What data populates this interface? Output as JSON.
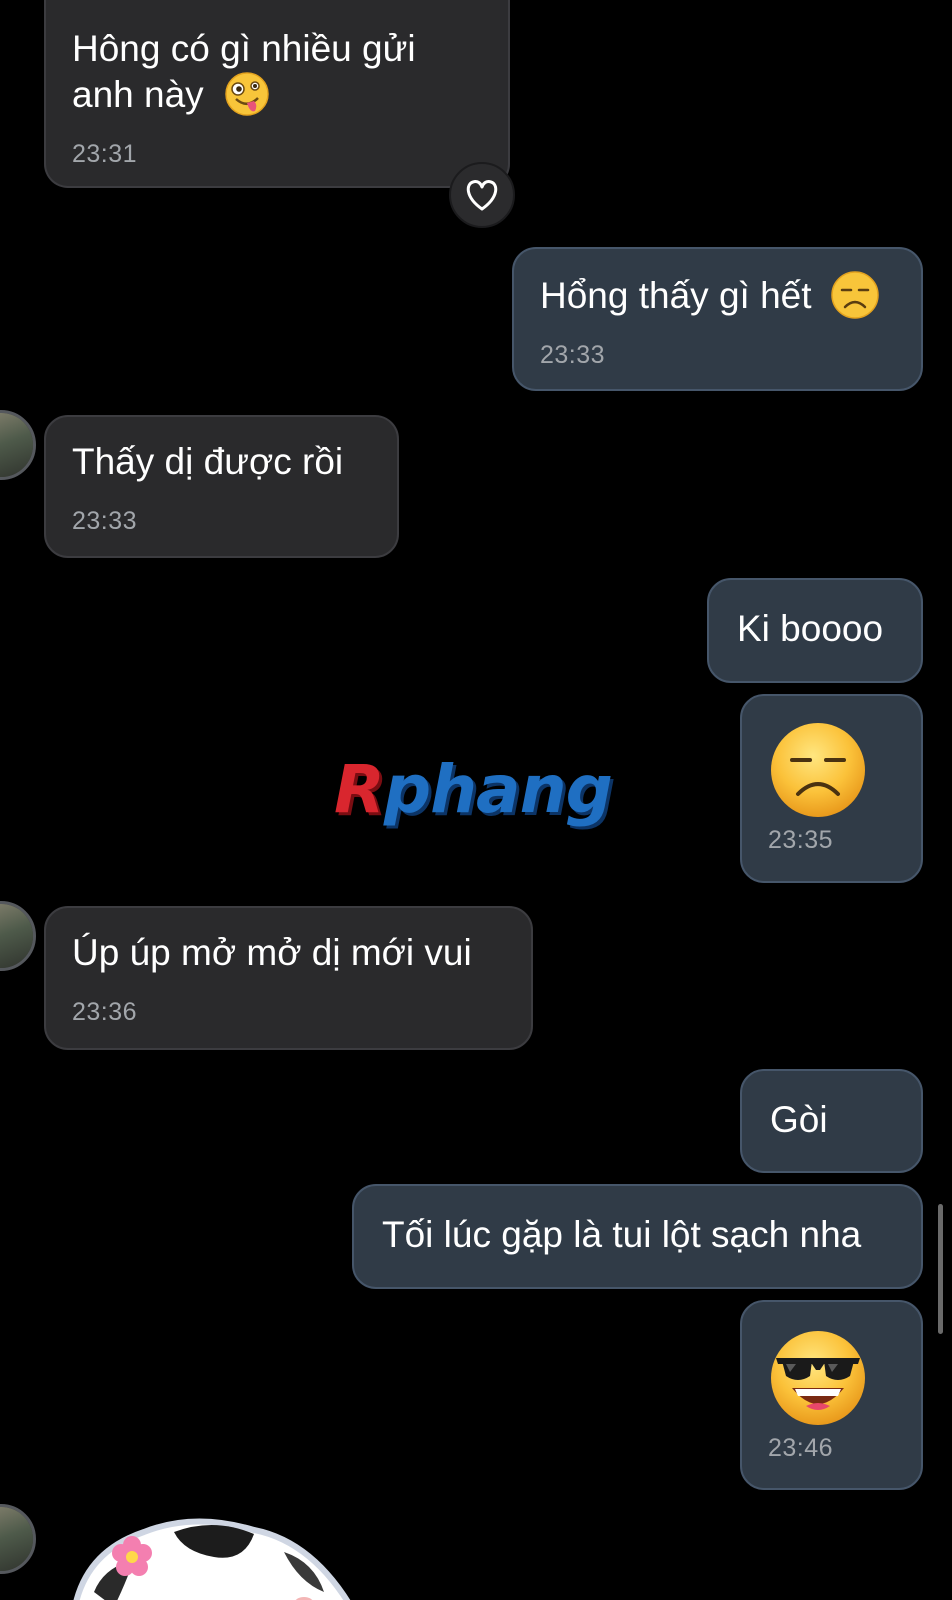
{
  "messages": [
    {
      "id": "m1",
      "side": "incoming",
      "lines": [
        "Hông có gì nhiều gửi",
        "anh này"
      ],
      "emoji": "zany-face",
      "time": "23:31",
      "reaction": "heart-icon"
    },
    {
      "id": "m2",
      "side": "outgoing",
      "text": "Hổng thấy gì hết",
      "emoji": "persevering-face",
      "time": "23:33"
    },
    {
      "id": "m3",
      "side": "incoming",
      "text": "Thấy dị được rồi",
      "time": "23:33"
    },
    {
      "id": "m4",
      "side": "outgoing",
      "text": "Ki boooo"
    },
    {
      "id": "m5",
      "side": "outgoing",
      "emoji": "persevering-face",
      "time": "23:35"
    },
    {
      "id": "m6",
      "side": "incoming",
      "text": "Úp úp mở mở dị mới vui",
      "time": "23:36"
    },
    {
      "id": "m7",
      "side": "outgoing",
      "text": "Gòi"
    },
    {
      "id": "m8",
      "side": "outgoing",
      "text": "Tối lúc gặp là tui lột sạch nha"
    },
    {
      "id": "m9",
      "side": "outgoing",
      "emoji": "sunglasses-face",
      "time": "23:46"
    },
    {
      "id": "m10",
      "side": "incoming",
      "sticker": "dog-with-flower-sticker"
    }
  ],
  "watermark": {
    "part1": "R",
    "part2": "phang"
  },
  "colors": {
    "background": "#000000",
    "incoming_bubble": "#2a2a2c",
    "outgoing_bubble": "#303b47",
    "timestamp": "#a2a6ab",
    "watermark_red": "#d9262e",
    "watermark_blue": "#1f6fc2"
  }
}
